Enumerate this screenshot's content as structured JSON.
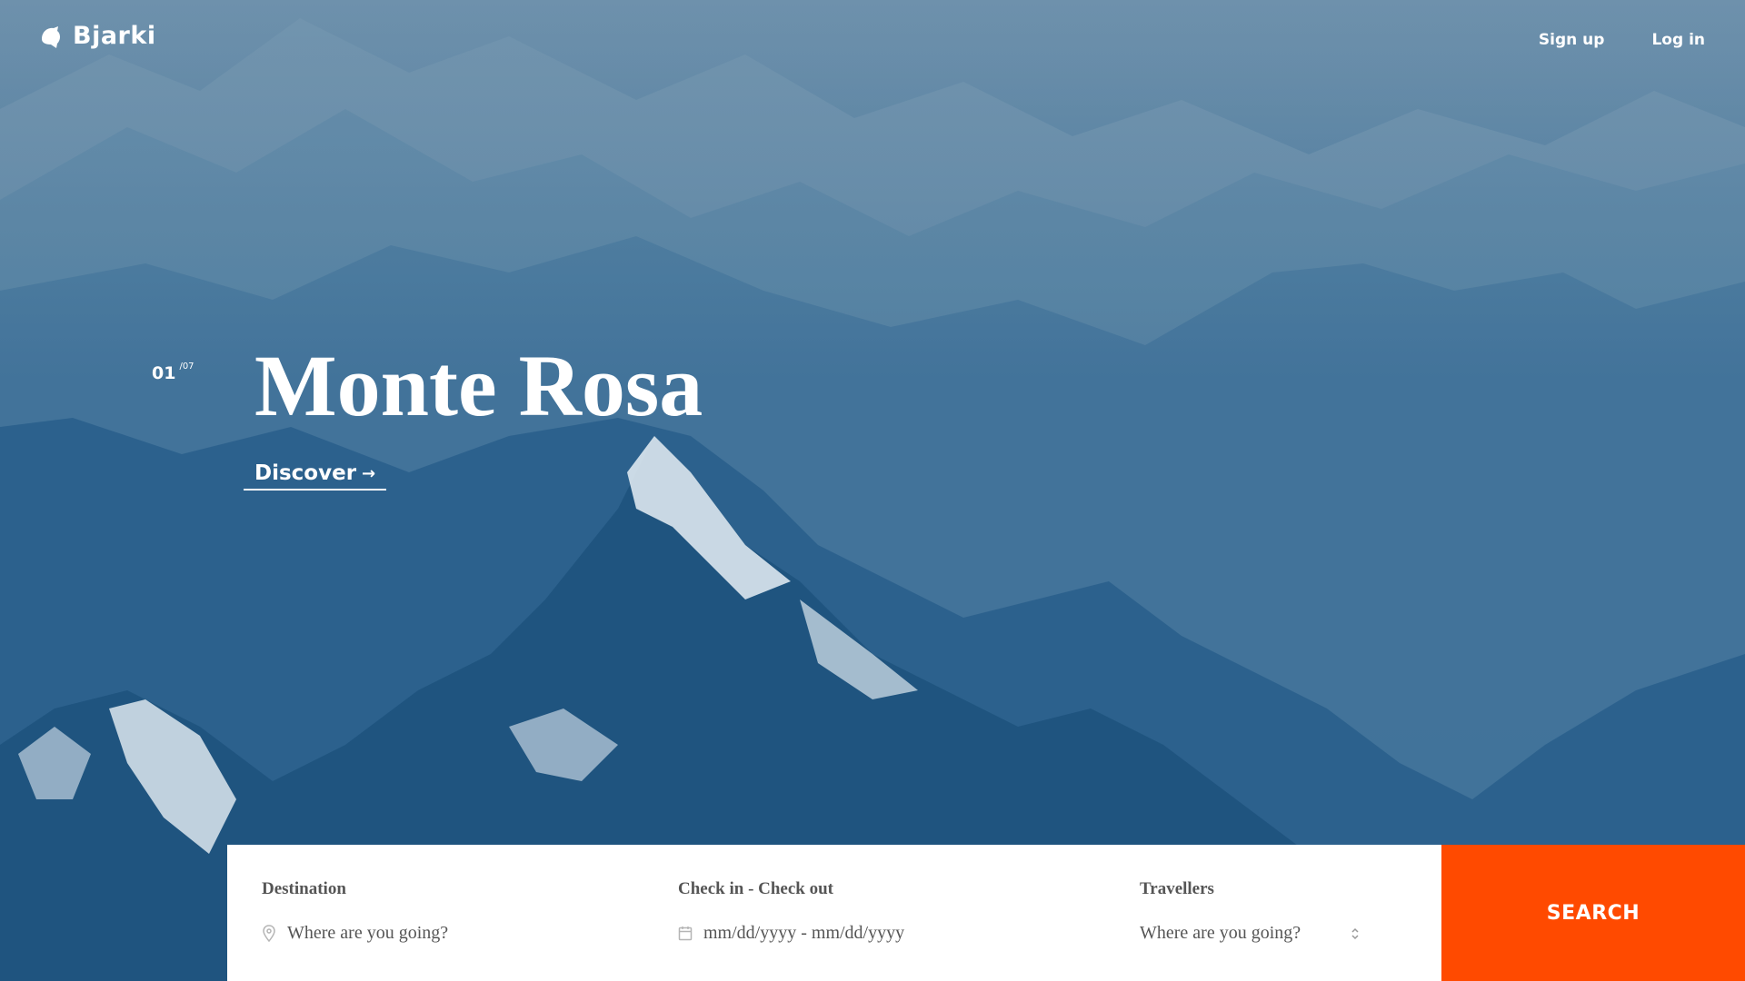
{
  "brand": {
    "name": "Bjarki",
    "logo_icon": "bird-logo-icon"
  },
  "nav": {
    "signup_label": "Sign up",
    "login_label": "Log in"
  },
  "hero": {
    "slide_current": "01",
    "slide_total": "/07",
    "title": "Monte Rosa",
    "discover_label": "Discover",
    "discover_icon": "arrow-right-icon",
    "background": "mountain-range-photo"
  },
  "search": {
    "destination": {
      "label": "Destination",
      "placeholder": "Where are you going?",
      "icon": "map-pin-icon"
    },
    "dates": {
      "label": "Check in - Check out",
      "placeholder": "mm/dd/yyyy - mm/dd/yyyy",
      "icon": "calendar-icon"
    },
    "travellers": {
      "label": "Travellers",
      "selected": "Where are you going?",
      "icon": "select-arrows-icon"
    },
    "button_label": "SEARCH"
  },
  "colors": {
    "accent": "#ff4a00",
    "sky": "#5f86a4",
    "mountain": "#1c5585",
    "text_dark": "#555555"
  }
}
